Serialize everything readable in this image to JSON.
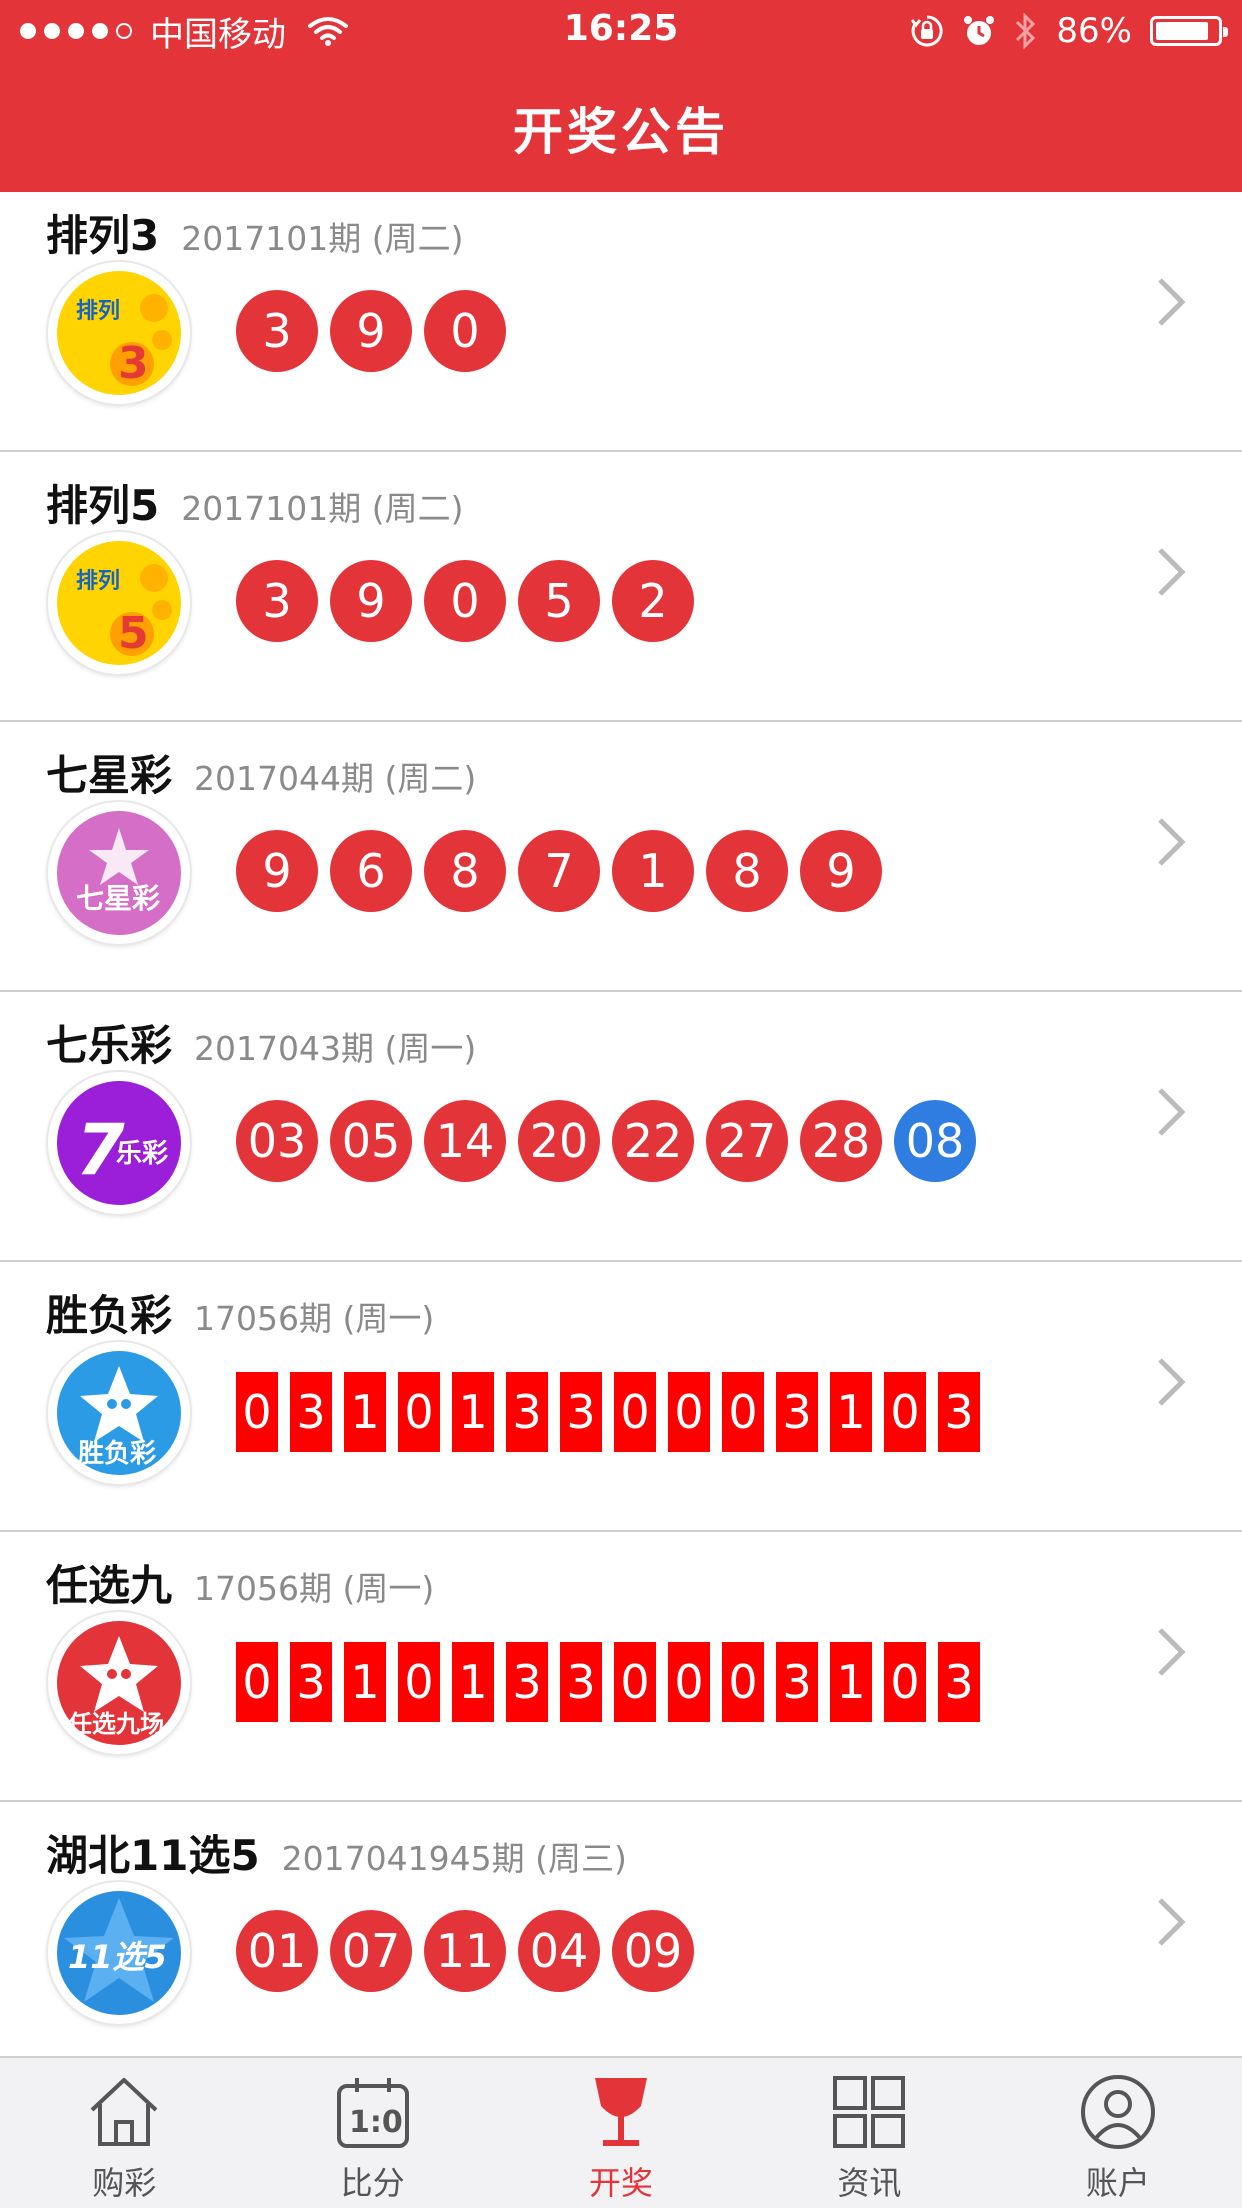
{
  "status_bar": {
    "carrier": "中国移动",
    "time": "16:25",
    "battery": "86%",
    "battery_level": 0.86
  },
  "header": {
    "title": "开奖公告"
  },
  "lotteries": [
    {
      "name": "排列3",
      "issue": "2017101期 (周二)",
      "logo_icon": "pailie3-logo",
      "numbers": [
        "3",
        "9",
        "0"
      ],
      "blue": []
    },
    {
      "name": "排列5",
      "issue": "2017101期 (周二)",
      "logo_icon": "pailie5-logo",
      "numbers": [
        "3",
        "9",
        "0",
        "5",
        "2"
      ],
      "blue": []
    },
    {
      "name": "七星彩",
      "issue": "2017044期 (周二)",
      "logo_icon": "qixingcai-logo",
      "numbers": [
        "9",
        "6",
        "8",
        "7",
        "1",
        "8",
        "9"
      ],
      "blue": []
    },
    {
      "name": "七乐彩",
      "issue": "2017043期 (周一)",
      "logo_icon": "qilecai-logo",
      "numbers": [
        "03",
        "05",
        "14",
        "20",
        "22",
        "27",
        "28"
      ],
      "blue": [
        "08"
      ]
    },
    {
      "name": "胜负彩",
      "issue": "17056期 (周一)",
      "logo_icon": "shengfucai-logo",
      "digits": [
        "0",
        "3",
        "1",
        "0",
        "1",
        "3",
        "3",
        "0",
        "0",
        "0",
        "3",
        "1",
        "0",
        "3"
      ]
    },
    {
      "name": "任选九",
      "issue": "17056期 (周一)",
      "logo_icon": "renxuanjiu-logo",
      "digits": [
        "0",
        "3",
        "1",
        "0",
        "1",
        "3",
        "3",
        "0",
        "0",
        "0",
        "3",
        "1",
        "0",
        "3"
      ]
    },
    {
      "name": "湖北11选5",
      "issue": "2017041945期 (周三)",
      "logo_icon": "hubei11x5-logo",
      "numbers": [
        "01",
        "07",
        "11",
        "04",
        "09"
      ],
      "blue": []
    }
  ],
  "logo_text": {
    "pailie_top": "排列",
    "pailie3_digit": "3",
    "pailie5_digit": "5",
    "qixingcai": "七星彩",
    "qilecai_7": "7",
    "qilecai_text": "乐彩",
    "shengfucai": "胜负彩",
    "renxuanjiu": "任选九场",
    "hubei": "11选5"
  },
  "tabbar": {
    "tabs": [
      {
        "label": "购彩",
        "icon": "home-icon",
        "active": false
      },
      {
        "label": "比分",
        "icon": "scoreboard-icon",
        "active": false
      },
      {
        "label": "开奖",
        "icon": "trophy-icon",
        "active": true
      },
      {
        "label": "资讯",
        "icon": "grid-icon",
        "active": false
      },
      {
        "label": "账户",
        "icon": "user-icon",
        "active": false
      }
    ]
  },
  "colors": {
    "accent": "#e3343a",
    "ball_red": "#e3343a",
    "ball_blue": "#2f7de1",
    "digit_red": "#ff0000"
  }
}
